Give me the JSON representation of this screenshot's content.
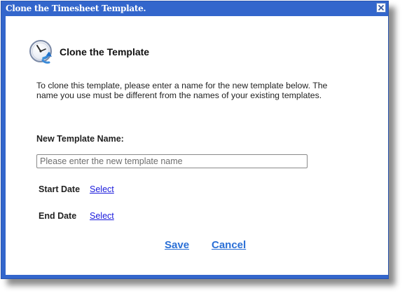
{
  "window": {
    "title": "Clone the Timesheet Template.",
    "close_icon": "close-icon"
  },
  "header": {
    "icon": "clock-clone-icon",
    "title": "Clone the Template"
  },
  "description": "To clone this template, please enter a name for the new template below. The name you use must be different from the names of your existing templates.",
  "form": {
    "name_label": "New Template Name:",
    "name_value": "",
    "name_placeholder": "Please enter the new template name",
    "start_date_label": "Start Date",
    "start_date_link": "Select",
    "end_date_label": "End Date",
    "end_date_link": "Select"
  },
  "actions": {
    "save_label": "Save",
    "cancel_label": "Cancel"
  },
  "colors": {
    "frame": "#3366cc",
    "link": "#1a1adc",
    "action_link": "#2a6fd6"
  }
}
